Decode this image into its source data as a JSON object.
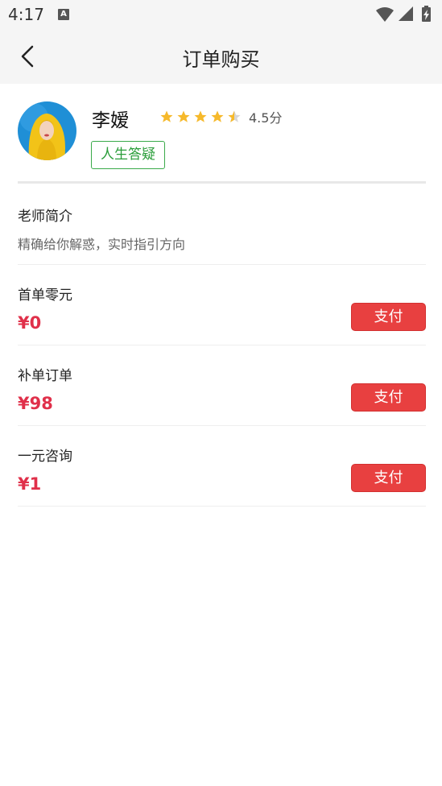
{
  "status_bar": {
    "time": "4:17",
    "notification_icon": "A"
  },
  "nav": {
    "title": "订单购买"
  },
  "profile": {
    "name": "李嫒",
    "rating": 4.5,
    "rating_label": "4.5分",
    "tag": "人生答疑"
  },
  "intro": {
    "title": "老师简介",
    "description": "精确给你解惑，实时指引方向"
  },
  "plans": [
    {
      "name": "首单零元",
      "price": "¥0",
      "button": "支付"
    },
    {
      "name": "补单订单",
      "price": "¥98",
      "button": "支付"
    },
    {
      "name": "一元咨询",
      "price": "¥1",
      "button": "支付"
    }
  ],
  "colors": {
    "price": "#e0304a",
    "pay_button": "#e84040",
    "tag": "#2a9d3a",
    "star": "#f6b92b"
  }
}
